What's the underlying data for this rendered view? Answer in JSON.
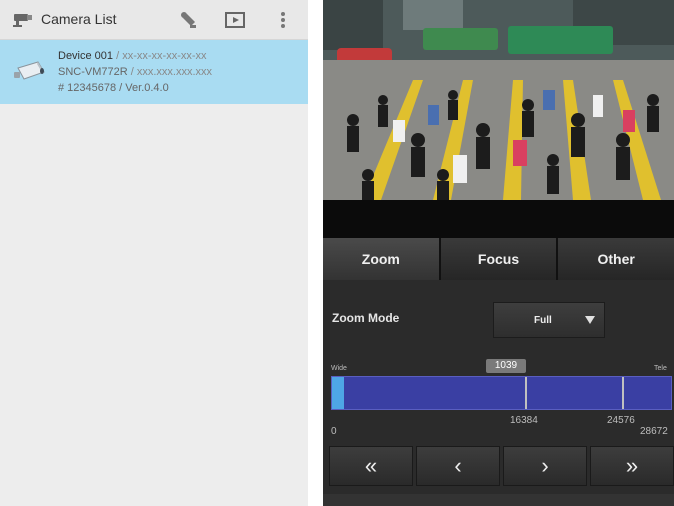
{
  "left": {
    "title": "Camera List",
    "device": {
      "name": "Device 001",
      "name_suffix": " / xx-xx-xx-xx-xx-xx",
      "model": "SNC-VM772R",
      "model_suffix": " / xxx.xxx.xxx.xxx",
      "serial": "# 12345678 / Ver.0.4.0"
    }
  },
  "right": {
    "tabs": [
      {
        "label": "Zoom"
      },
      {
        "label": "Focus"
      },
      {
        "label": "Other"
      }
    ],
    "zoom_mode": {
      "label": "Zoom Mode",
      "selected": "Full"
    },
    "slider": {
      "wide_label": "Wide",
      "tele_label": "Tele",
      "current_value": "1039",
      "min": 0,
      "max": 28672,
      "current": 1039,
      "marks": [
        16384,
        24576
      ],
      "min_label": "0",
      "mark_labels": [
        "16384",
        "24576"
      ],
      "max_label": "28672"
    },
    "nav_buttons": [
      {
        "label": "«"
      },
      {
        "label": "‹"
      },
      {
        "label": "›"
      },
      {
        "label": "»"
      }
    ]
  },
  "colors": {
    "selection_row": "#a9dcf2",
    "bar_track": "#3a3fa3",
    "bar_fill": "#4ea6e6"
  }
}
